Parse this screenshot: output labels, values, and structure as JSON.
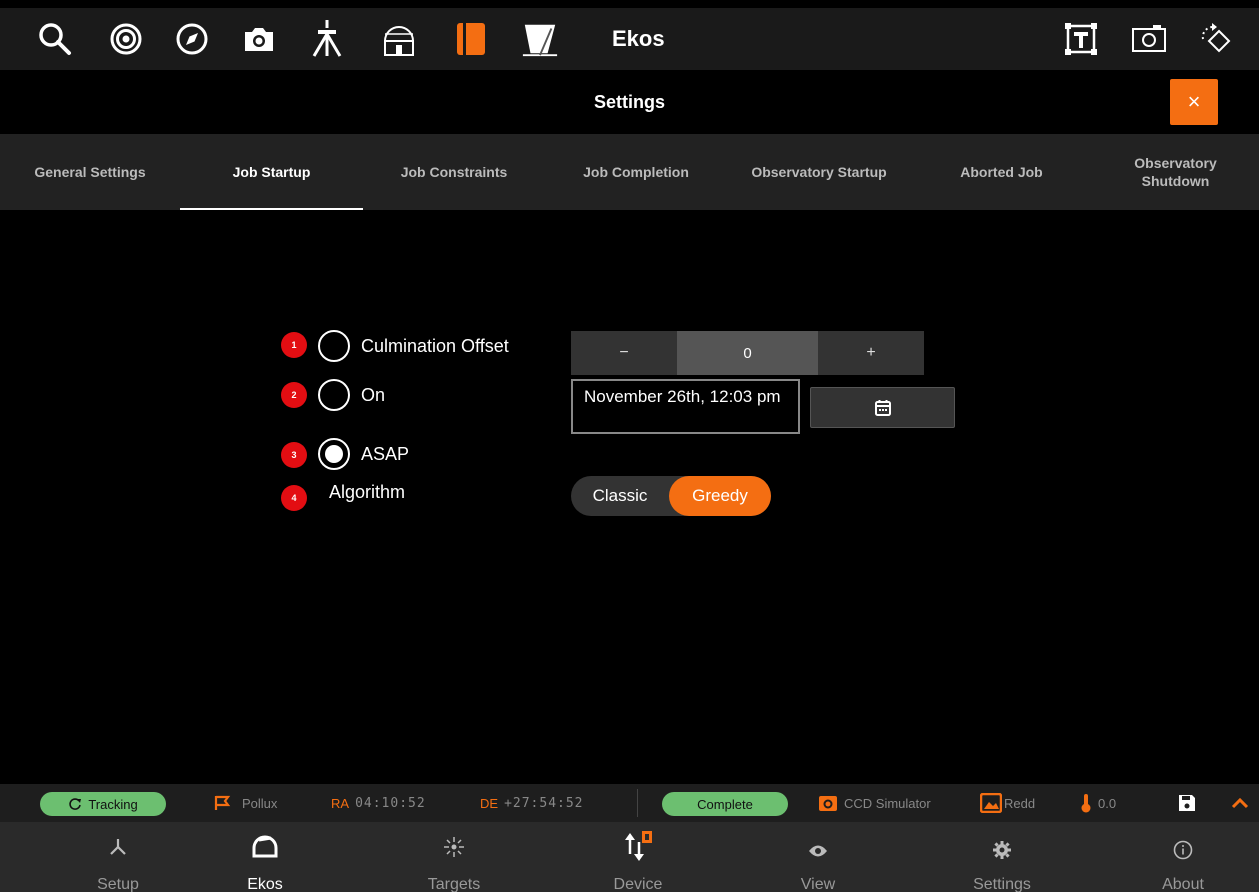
{
  "toolbar": {
    "title": "Ekos",
    "icons": [
      "search-icon",
      "target-icon",
      "compass-icon",
      "camera-icon",
      "mount-icon",
      "observatory-icon",
      "scheduler-icon",
      "telescope-icon",
      "text-frame-icon",
      "frame-icon",
      "rotate-icon"
    ],
    "accent": "#f46e12"
  },
  "settings": {
    "title": "Settings",
    "close_label": "×"
  },
  "tabs": [
    {
      "label": "General Settings"
    },
    {
      "label": "Job Startup",
      "active": true
    },
    {
      "label": "Job Constraints"
    },
    {
      "label": "Job Completion"
    },
    {
      "label": "Observatory Startup"
    },
    {
      "label": "Aborted Job"
    },
    {
      "label": "Observatory Shutdown"
    }
  ],
  "options": {
    "badges": [
      "1",
      "2",
      "3",
      "4"
    ],
    "culmination_label": "Culmination Offset",
    "on_label": "On",
    "asap_label": "ASAP",
    "algorithm_label": "Algorithm",
    "selected": "ASAP"
  },
  "stepper": {
    "minus": "−",
    "value": "0",
    "plus": "+"
  },
  "date_field": {
    "value": "November 26th, 12:03 pm"
  },
  "algorithm": {
    "options": [
      "Classic",
      "Greedy"
    ],
    "selected": "Greedy"
  },
  "status": {
    "tracking": "Tracking",
    "target": "Pollux",
    "ra_label": "RA",
    "ra_value": "04:10:52",
    "de_label": "DE",
    "de_value": "+27:54:52",
    "capture_status": "Complete",
    "camera": "CCD Simulator",
    "filter": "Redd",
    "temperature": "0.0",
    "pill_color": "#6cbf70"
  },
  "nav": [
    {
      "label": "Setup",
      "icon": "setup-icon"
    },
    {
      "label": "Ekos",
      "icon": "ekos-icon",
      "active": true
    },
    {
      "label": "Targets",
      "icon": "targets-icon"
    },
    {
      "label": "Device",
      "icon": "device-icon"
    },
    {
      "label": "View",
      "icon": "view-icon"
    },
    {
      "label": "Settings",
      "icon": "settings-icon"
    },
    {
      "label": "About",
      "icon": "about-icon"
    }
  ]
}
